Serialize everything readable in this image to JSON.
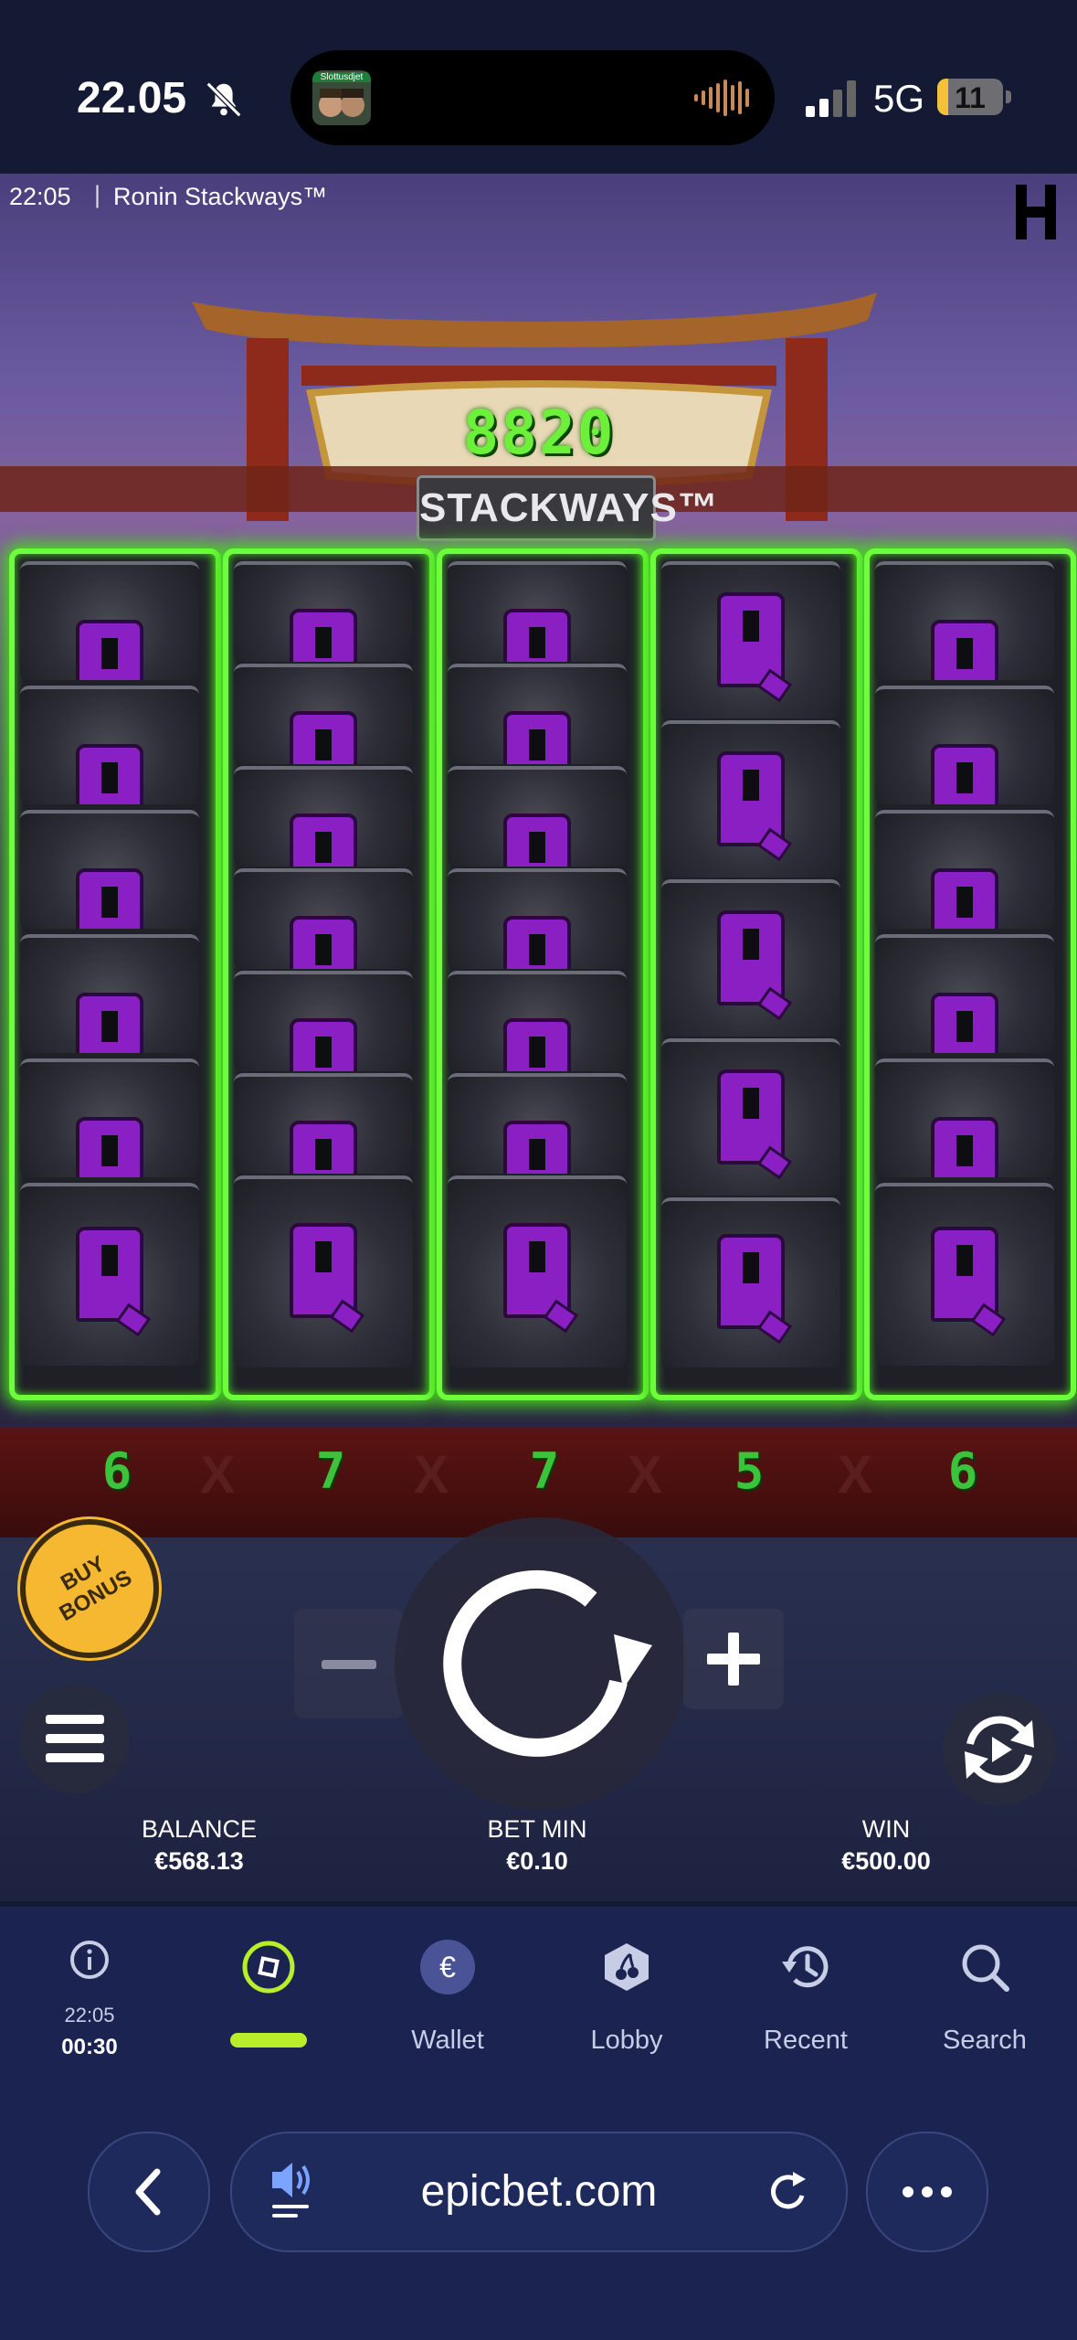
{
  "status_bar": {
    "time": "22.05",
    "network": "5G",
    "battery": "11",
    "island_label": "Slottusdjet"
  },
  "game": {
    "header_time": "22:05",
    "header_separator": "|",
    "title": "Ronin Stackways™",
    "multiplier": "8820",
    "banner": "STACKWAYS™",
    "reel_counts": [
      "6",
      "7",
      "7",
      "5",
      "6"
    ],
    "count_separator": "X",
    "buy_bonus": "BUY BONUS",
    "balance_label": "BALANCE",
    "balance_value": "€568.13",
    "bet_label": "BET MIN",
    "bet_value": "€0.10",
    "win_label": "WIN",
    "win_value": "€500.00"
  },
  "bottom_nav": {
    "info_time": "22:05",
    "session_time": "00:30",
    "wallet": "Wallet",
    "lobby": "Lobby",
    "recent": "Recent",
    "search": "Search"
  },
  "browser": {
    "url": "epicbet.com"
  },
  "colors": {
    "win_glow": "#6dff3a",
    "symbol": "#8a1fc4",
    "active_tab": "#b8ee2a",
    "nav_bg": "#1b2350"
  },
  "icons": [
    "bell-slash-icon",
    "signal-icon",
    "info-icon",
    "game-icon",
    "euro-icon",
    "cherry-icon",
    "history-icon",
    "search-icon",
    "back-icon",
    "speaker-icon",
    "reload-icon",
    "more-icon",
    "menu-icon",
    "spin-icon",
    "autoplay-icon"
  ]
}
